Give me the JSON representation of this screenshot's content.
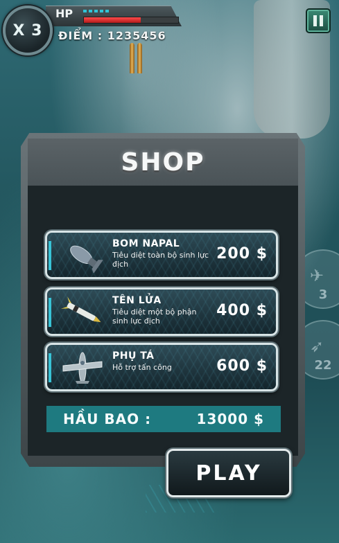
{
  "hud": {
    "lives": "X 3",
    "hp_label": "HP",
    "hp_level": 0.6,
    "score": "ĐIỂM : 1235456"
  },
  "side_buttons": [
    {
      "icon": "plane-icon",
      "count": "3"
    },
    {
      "icon": "missile-icon",
      "count": "22"
    }
  ],
  "shop": {
    "title": "SHOP",
    "items": [
      {
        "name": "BOM NAPAL",
        "desc": "Tiêu diệt toàn bộ sinh lực địch",
        "price": "200 $",
        "icon": "bomb-icon"
      },
      {
        "name": "TÊN LỬA",
        "desc": "Tiêu diệt một bộ phận sinh lực địch",
        "price": "400 $",
        "icon": "missile-icon"
      },
      {
        "name": "PHỤ TÁ",
        "desc": "Hỗ trợ tấn công",
        "price": "600 $",
        "icon": "plane-icon"
      }
    ],
    "wallet_label": "HẦU BAO :",
    "wallet_value": "13000 $"
  },
  "play_label": "PLAY",
  "colors": {
    "accent": "#38c3d6",
    "wallet_bg": "#1e7a80",
    "hp_red": "#e23232"
  }
}
